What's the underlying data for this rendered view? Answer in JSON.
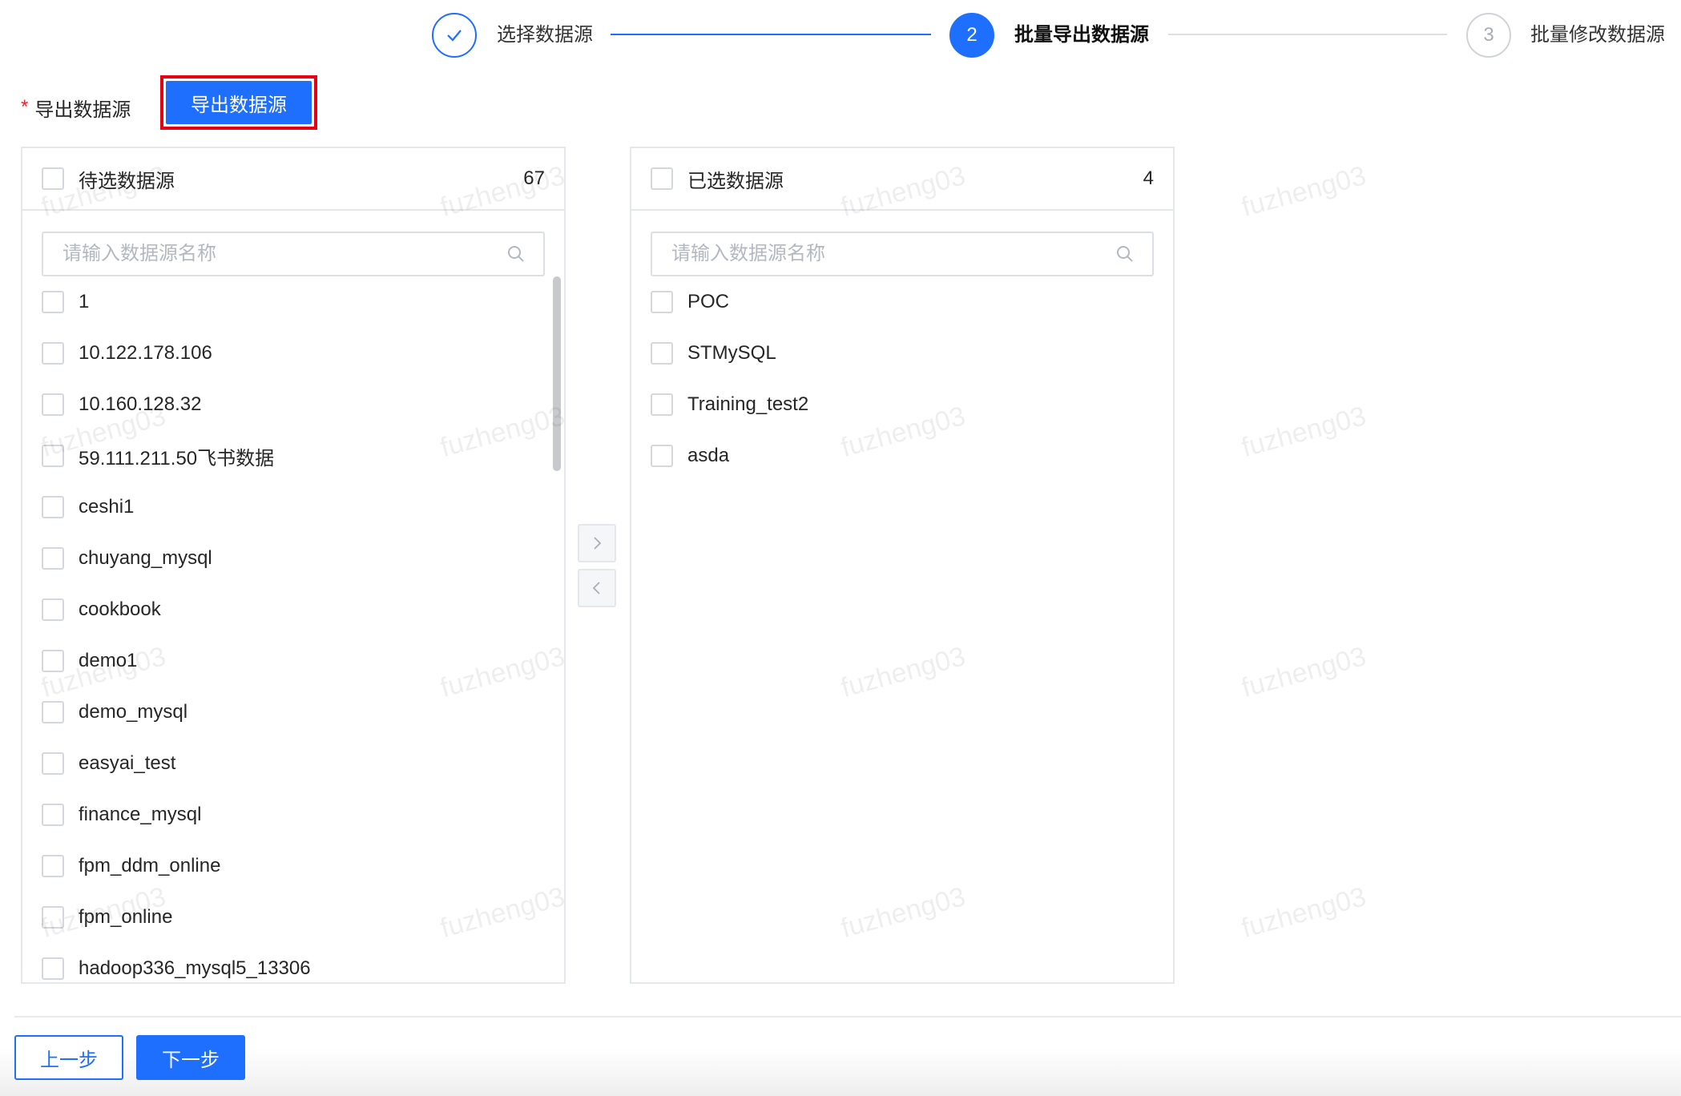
{
  "steps": [
    {
      "label": "选择数据源",
      "status": "done",
      "icon": "check-icon"
    },
    {
      "number": "2",
      "label": "批量导出数据源",
      "status": "active"
    },
    {
      "number": "3",
      "label": "批量修改数据源",
      "status": "wait"
    }
  ],
  "export": {
    "label": "导出数据源",
    "button_label": "导出数据源"
  },
  "left_panel": {
    "title": "待选数据源",
    "count": "67",
    "search_placeholder": "请输入数据源名称",
    "items": [
      "1",
      "10.122.178.106",
      "10.160.128.32",
      "59.111.211.50飞书数据",
      "ceshi1",
      "chuyang_mysql",
      "cookbook",
      "demo1",
      "demo_mysql",
      "easyai_test",
      "finance_mysql",
      "fpm_ddm_online",
      "fpm_online",
      "hadoop336_mysql5_13306"
    ]
  },
  "right_panel": {
    "title": "已选数据源",
    "count": "4",
    "search_placeholder": "请输入数据源名称",
    "items": [
      "POC",
      "STMySQL",
      "Training_test2",
      "asda"
    ]
  },
  "watermark": "fuzheng03",
  "footer": {
    "prev_label": "上一步",
    "next_label": "下一步"
  },
  "colors": {
    "primary": "#1f6fff",
    "highlight_border": "#e60012",
    "required": "#f5222d"
  }
}
